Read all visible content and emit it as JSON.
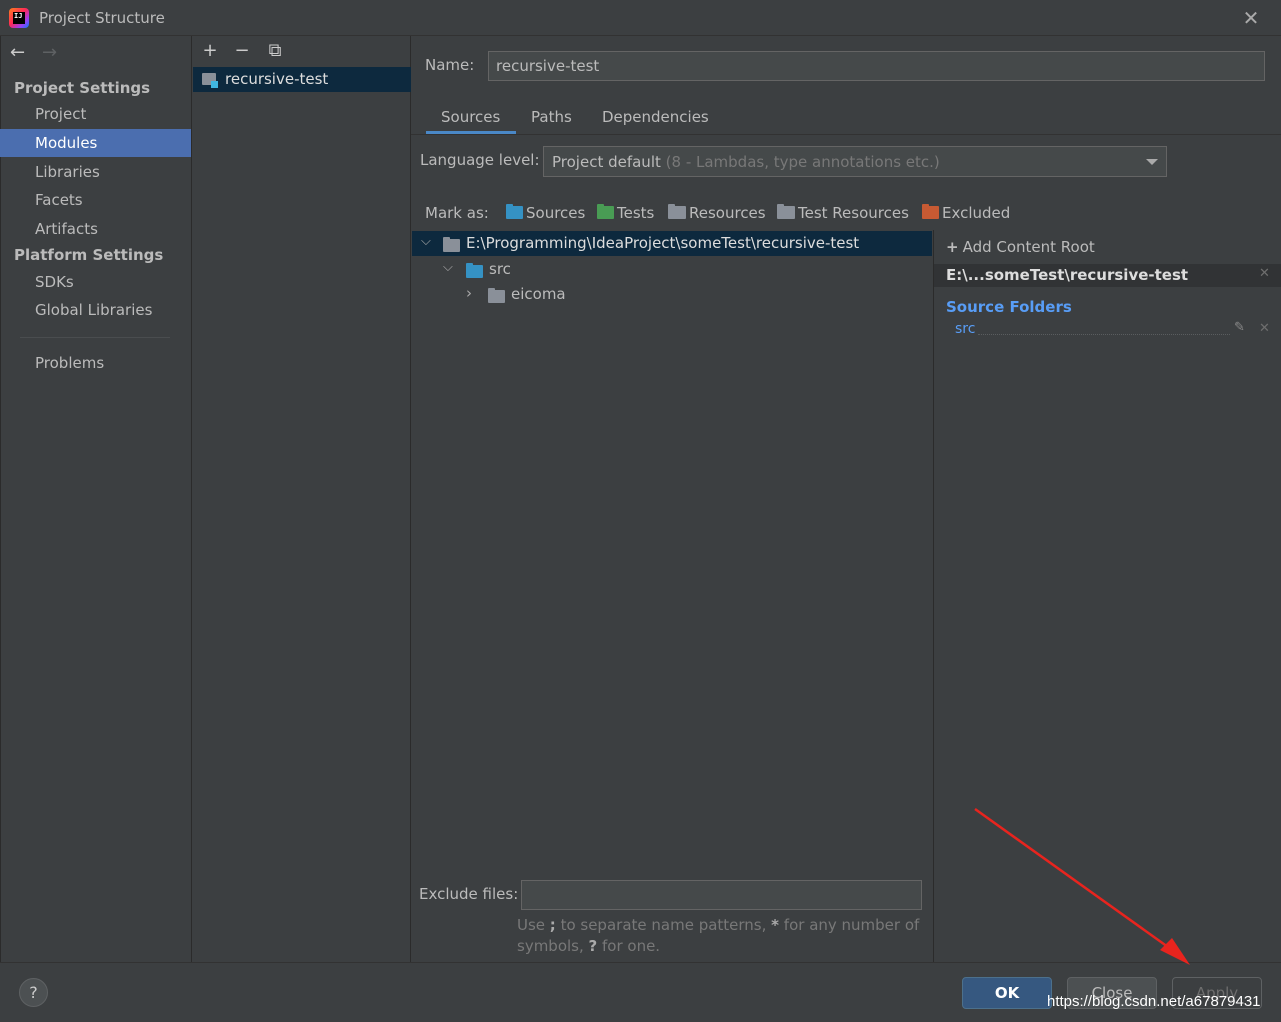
{
  "window": {
    "title": "Project Structure",
    "close_glyph": "✕"
  },
  "nav": {
    "back_glyph": "←",
    "forward_glyph": "→",
    "project_settings_heading": "Project Settings",
    "platform_settings_heading": "Platform Settings",
    "project_settings_items": [
      "Project",
      "Modules",
      "Libraries",
      "Facets",
      "Artifacts"
    ],
    "platform_settings_items": [
      "SDKs",
      "Global Libraries"
    ],
    "problems": "Problems",
    "selected": "Modules"
  },
  "toolbar": {
    "add_glyph": "+",
    "remove_glyph": "−",
    "copy_glyph": "⧉"
  },
  "modules": [
    {
      "name": "recursive-test"
    }
  ],
  "module_detail": {
    "name_label": "Name:",
    "name_value": "recursive-test",
    "tabs": [
      "Sources",
      "Paths",
      "Dependencies"
    ],
    "active_tab": "Sources",
    "language_level_label": "Language level:",
    "language_level_value": "Project default",
    "language_level_hint": "(8 - Lambdas, type annotations etc.)",
    "mark_as_label": "Mark as:",
    "mark_as": [
      {
        "label": "Sources",
        "color": "#3592c4"
      },
      {
        "label": "Tests",
        "color": "#499c54"
      },
      {
        "label": "Resources",
        "color": "#8a9099"
      },
      {
        "label": "Test Resources",
        "color": "#8a9099"
      },
      {
        "label": "Excluded",
        "color": "#c75a33"
      }
    ],
    "tree": {
      "root": "E:\\Programming\\IdeaProject\\someTest\\recursive-test",
      "children": [
        {
          "name": "src",
          "expanded": true,
          "folder_color": "#3592c4",
          "children": [
            {
              "name": "eicoma",
              "expanded": false,
              "folder_color": "#8a9099"
            }
          ]
        }
      ]
    },
    "add_content_root": "Add Content Root",
    "content_root_path": "E:\\...someTest\\recursive-test",
    "source_folders_heading": "Source Folders",
    "source_folders": [
      "src"
    ],
    "exclude_files_label": "Exclude files:",
    "exclude_files_value": "",
    "exclude_hint_line1_a": "Use ",
    "exclude_hint_sep": ";",
    "exclude_hint_line1_b": " to separate name patterns, ",
    "exclude_hint_star": "*",
    "exclude_hint_line1_c": " for any number of",
    "exclude_hint_line2_a": "symbols, ",
    "exclude_hint_q": "?",
    "exclude_hint_line2_b": " for one."
  },
  "footer": {
    "help_glyph": "?",
    "ok": "OK",
    "close": "Close",
    "apply": "Apply",
    "watermark": "https://blog.csdn.net/a67879431"
  },
  "colors": {
    "background": "#3c3f41",
    "selection": "#4b6eaf",
    "tree_selection": "#0d293e",
    "link_blue": "#589df6",
    "annotation_red": "#e8241e"
  }
}
